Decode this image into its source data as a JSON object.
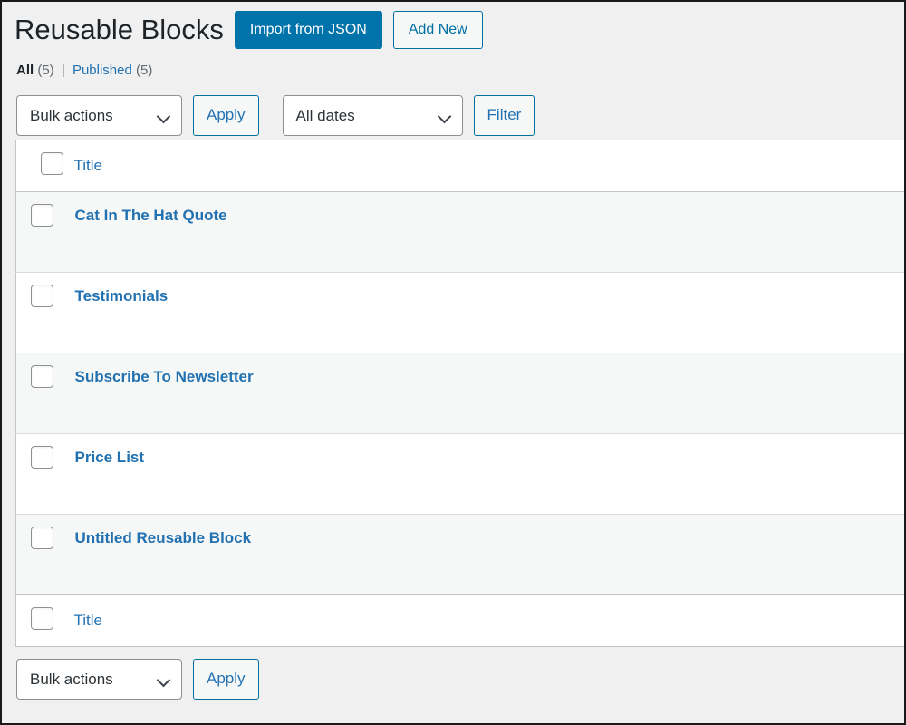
{
  "header": {
    "title": "Reusable Blocks",
    "import_button": "Import from JSON",
    "add_new_button": "Add New"
  },
  "status_nav": {
    "all_label": "All",
    "all_count": "(5)",
    "separator": "|",
    "published_label": "Published",
    "published_count": "(5)"
  },
  "tablenav_top": {
    "bulk_actions_value": "Bulk actions",
    "apply_label": "Apply",
    "dates_value": "All dates",
    "filter_label": "Filter"
  },
  "tablenav_bottom": {
    "bulk_actions_value": "Bulk actions",
    "apply_label": "Apply"
  },
  "table": {
    "column_title": "Title",
    "footer_title": "Title",
    "rows": [
      {
        "title": "Cat In The Hat Quote"
      },
      {
        "title": "Testimonials"
      },
      {
        "title": "Subscribe To Newsletter"
      },
      {
        "title": "Price List"
      },
      {
        "title": "Untitled Reusable Block"
      }
    ]
  },
  "colors": {
    "primary": "#0073aa",
    "link": "#2271b1",
    "page_bg": "#f0f0f1",
    "row_alt_bg": "#f6f7f7",
    "border": "#c3c4c7"
  }
}
